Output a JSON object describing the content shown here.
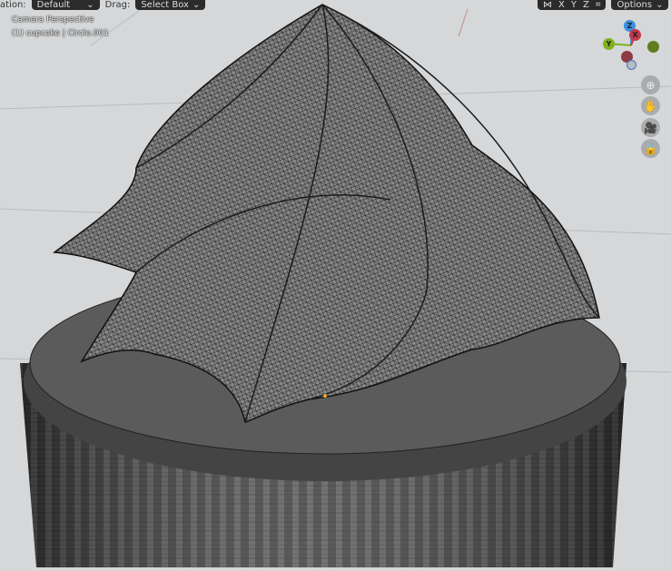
{
  "header": {
    "orientation_label": "ation:",
    "orientation_value": "Default",
    "drag_label": "Drag:",
    "drag_value": "Select Box",
    "axis_x": "X",
    "axis_y": "Y",
    "axis_z": "Z",
    "options_label": "Options"
  },
  "overlay": {
    "view_name": "Camera Perspective",
    "object_info": "(1) cupcake | Circle.001"
  },
  "gizmo": {
    "z": "Z",
    "x": "X",
    "y": "Y"
  },
  "colors": {
    "background": "#d5d7d9",
    "header": "#2b2b2b",
    "x_axis": "#c4384a",
    "y_axis": "#7fb21c",
    "z_axis": "#3a8fe0"
  }
}
